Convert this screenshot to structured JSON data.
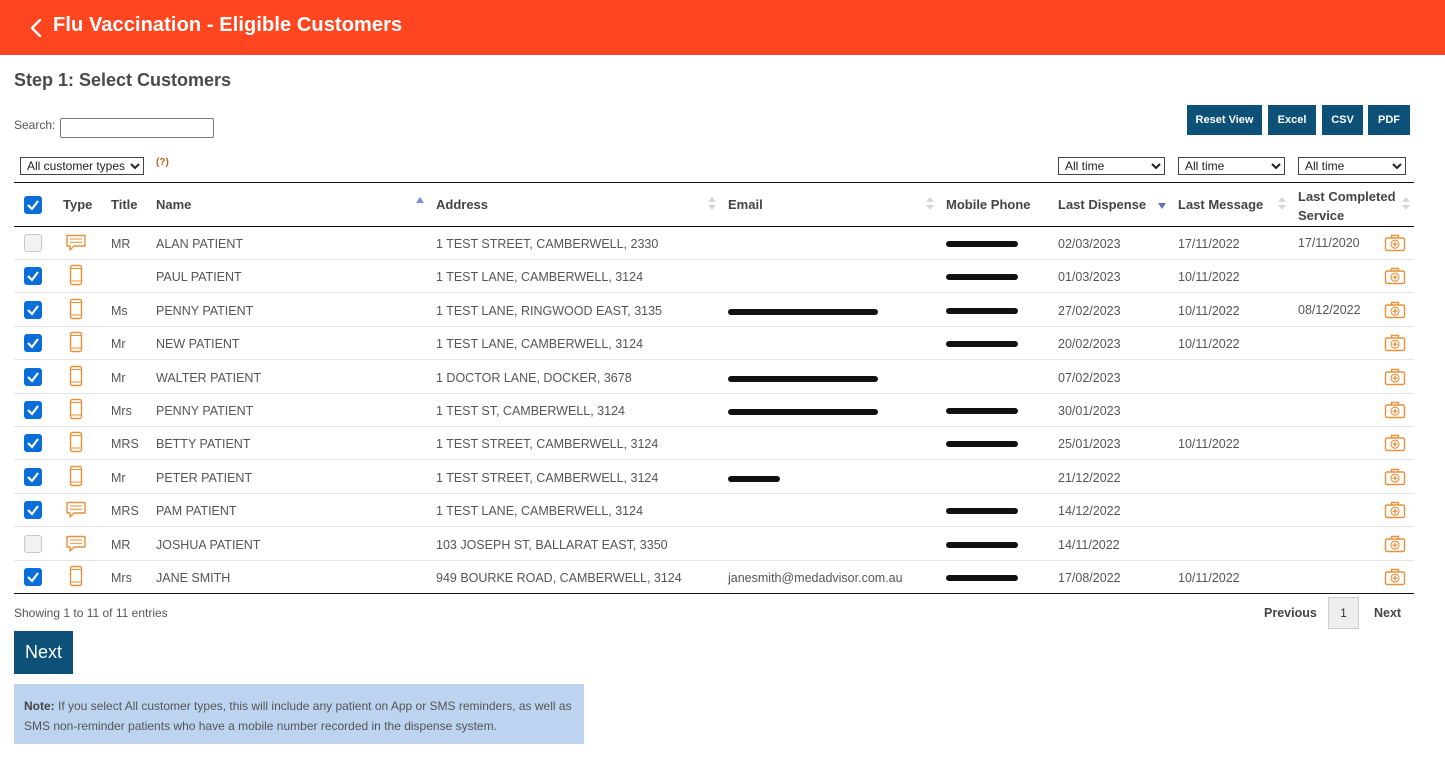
{
  "header": {
    "title": "Flu Vaccination - Eligible Customers",
    "back_icon": "chevron-left-icon"
  },
  "step_title": "Step 1: Select Customers",
  "search": {
    "label": "Search:",
    "value": ""
  },
  "export_buttons": [
    "Reset View",
    "Excel",
    "CSV",
    "PDF"
  ],
  "filters": {
    "customer_type": "All customer types",
    "help": "(?)",
    "last_dispense": "All time",
    "last_message": "All time",
    "last_completed_service": "All time"
  },
  "columns": [
    "Type",
    "Title",
    "Name",
    "Address",
    "Email",
    "Mobile Phone",
    "Last Dispense",
    "Last Message",
    "Last Completed Service"
  ],
  "rows": [
    {
      "checked": false,
      "type": "message-icon",
      "title": "MR",
      "name": "ALAN PATIENT",
      "address": "1 TEST STREET, CAMBERWELL, 2330",
      "email": "",
      "phone_redacted": true,
      "last_dispense": "02/03/2023",
      "last_message": "17/11/2022",
      "last_service": "17/11/2020"
    },
    {
      "checked": true,
      "type": "mobile-icon",
      "title": "",
      "name": "PAUL PATIENT",
      "address": "1 TEST LANE, CAMBERWELL, 3124",
      "email": "",
      "phone_redacted": true,
      "last_dispense": "01/03/2023",
      "last_message": "10/11/2022",
      "last_service": ""
    },
    {
      "checked": true,
      "type": "mobile-icon",
      "title": "Ms",
      "name": "PENNY PATIENT",
      "address": "1 TEST LANE, RINGWOOD EAST, 3135",
      "email": "",
      "email_redacted": true,
      "phone_redacted": true,
      "last_dispense": "27/02/2023",
      "last_message": "10/11/2022",
      "last_service": "08/12/2022"
    },
    {
      "checked": true,
      "type": "mobile-icon",
      "title": "Mr",
      "name": "NEW PATIENT",
      "address": "1 TEST LANE, CAMBERWELL, 3124",
      "email": "",
      "phone_redacted": true,
      "last_dispense": "20/02/2023",
      "last_message": "10/11/2022",
      "last_service": ""
    },
    {
      "checked": true,
      "type": "mobile-icon",
      "title": "Mr",
      "name": "WALTER PATIENT",
      "address": "1 DOCTOR LANE, DOCKER, 3678",
      "email": "",
      "email_redacted": true,
      "phone_redacted": false,
      "last_dispense": "07/02/2023",
      "last_message": "",
      "last_service": ""
    },
    {
      "checked": true,
      "type": "mobile-icon",
      "title": "Mrs",
      "name": "PENNY PATIENT",
      "address": "1 TEST ST, CAMBERWELL, 3124",
      "email": "",
      "email_redacted": true,
      "phone_redacted": true,
      "last_dispense": "30/01/2023",
      "last_message": "",
      "last_service": ""
    },
    {
      "checked": true,
      "type": "mobile-icon",
      "title": "MRS",
      "name": "BETTY PATIENT",
      "address": "1 TEST STREET, CAMBERWELL, 3124",
      "email": "",
      "phone_redacted": true,
      "last_dispense": "25/01/2023",
      "last_message": "10/11/2022",
      "last_service": ""
    },
    {
      "checked": true,
      "type": "mobile-icon",
      "title": "Mr",
      "name": "PETER PATIENT",
      "address": "1 TEST STREET, CAMBERWELL, 3124",
      "email": "",
      "email_redacted": true,
      "email_redact_short": true,
      "phone_redacted": false,
      "last_dispense": "21/12/2022",
      "last_message": "",
      "last_service": ""
    },
    {
      "checked": true,
      "type": "message-icon",
      "title": "MRS",
      "name": "PAM PATIENT",
      "address": "1 TEST LANE, CAMBERWELL, 3124",
      "email": "",
      "phone_redacted": true,
      "last_dispense": "14/12/2022",
      "last_message": "",
      "last_service": ""
    },
    {
      "checked": false,
      "type": "message-icon",
      "title": "MR",
      "name": "JOSHUA PATIENT",
      "address": "103 JOSEPH ST, BALLARAT EAST, 3350",
      "email": "",
      "phone_redacted": true,
      "last_dispense": "14/11/2022",
      "last_message": "",
      "last_service": ""
    },
    {
      "checked": true,
      "type": "mobile-icon",
      "title": "Mrs",
      "name": "JANE SMITH",
      "address": "949 BOURKE ROAD, CAMBERWELL, 3124",
      "email": "janesmith@medadvisor.com.au",
      "phone_redacted": true,
      "last_dispense": "17/08/2022",
      "last_message": "10/11/2022",
      "last_service": ""
    }
  ],
  "footer": {
    "info": "Showing 1 to 11 of 11 entries",
    "prev": "Previous",
    "page": "1",
    "next": "Next"
  },
  "next_button": "Next",
  "note": {
    "label": "Note:",
    "text": " If you select All customer types, this will include any patient on App or SMS reminders, as well as SMS non-reminder patients who have a mobile number recorded in the dispense system."
  },
  "colors": {
    "header": "#ff4620",
    "button": "#0d5178",
    "checkbox": "#0a6ed8",
    "icon": "#e8913a",
    "note_bg": "#bcd4f0"
  }
}
